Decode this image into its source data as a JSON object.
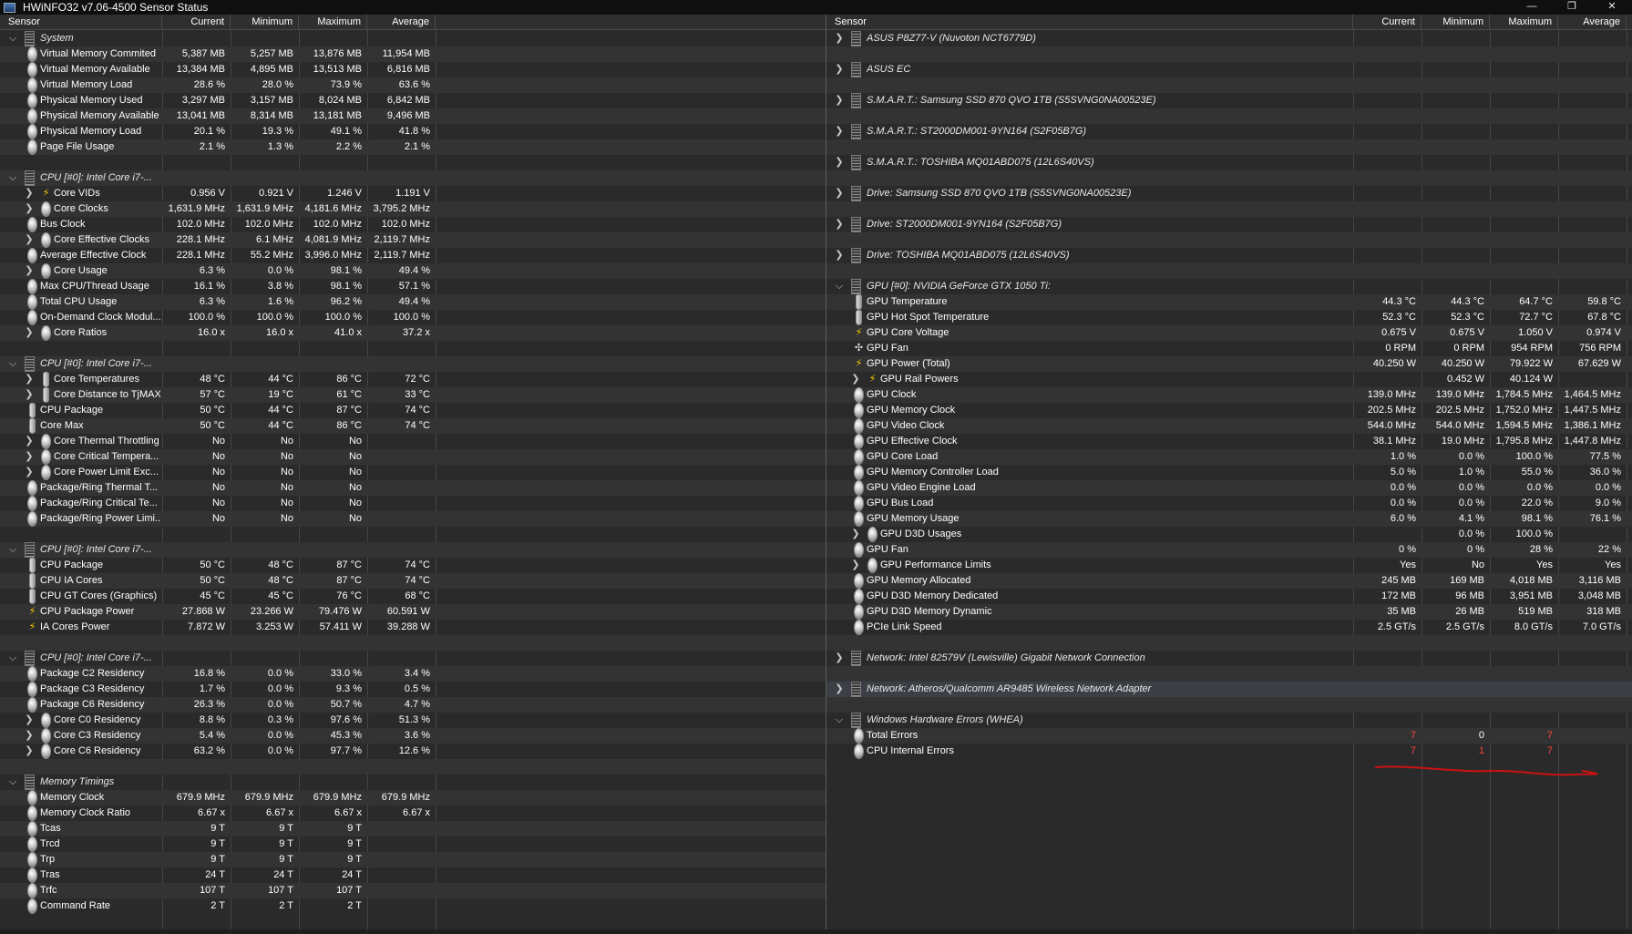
{
  "window": {
    "title": "HWiNFO32 v7.06-4500 Sensor Status",
    "minimize_glyph": "—",
    "restore_glyph": "❐",
    "close_glyph": "✕"
  },
  "columns": [
    "Sensor",
    "Current",
    "Minimum",
    "Maximum",
    "Average"
  ],
  "colors": {
    "background": "#2a2a2a",
    "alt_row": "#333333",
    "selected_row": "#3c4046",
    "error_value": "#ff4040",
    "voltage_icon": "#ffcc00",
    "annotation_line": "#cc1111"
  },
  "left_panel": {
    "rows": [
      {
        "type": "group",
        "label": "System"
      },
      {
        "type": "item",
        "indent": 0,
        "icon": "dot",
        "label": "Virtual Memory Commited",
        "cur": "5,387 MB",
        "min": "5,257 MB",
        "max": "13,876 MB",
        "avg": "11,954 MB"
      },
      {
        "type": "item",
        "indent": 0,
        "icon": "dot",
        "label": "Virtual Memory Available",
        "cur": "13,384 MB",
        "min": "4,895 MB",
        "max": "13,513 MB",
        "avg": "6,816 MB"
      },
      {
        "type": "item",
        "indent": 0,
        "icon": "dot",
        "label": "Virtual Memory Load",
        "cur": "28.6 %",
        "min": "28.0 %",
        "max": "73.9 %",
        "avg": "63.6 %"
      },
      {
        "type": "item",
        "indent": 0,
        "icon": "dot",
        "label": "Physical Memory Used",
        "cur": "3,297 MB",
        "min": "3,157 MB",
        "max": "8,024 MB",
        "avg": "6,842 MB"
      },
      {
        "type": "item",
        "indent": 0,
        "icon": "dot",
        "label": "Physical Memory Available",
        "cur": "13,041 MB",
        "min": "8,314 MB",
        "max": "13,181 MB",
        "avg": "9,496 MB"
      },
      {
        "type": "item",
        "indent": 0,
        "icon": "dot",
        "label": "Physical Memory Load",
        "cur": "20.1 %",
        "min": "19.3 %",
        "max": "49.1 %",
        "avg": "41.8 %"
      },
      {
        "type": "item",
        "indent": 0,
        "icon": "dot",
        "label": "Page File Usage",
        "cur": "2.1 %",
        "min": "1.3 %",
        "max": "2.2 %",
        "avg": "2.1 %"
      },
      {
        "type": "spacer"
      },
      {
        "type": "group",
        "label": "CPU [#0]: Intel Core i7-..."
      },
      {
        "type": "item",
        "indent": 1,
        "expand": true,
        "icon": "bolt",
        "label": "Core VIDs",
        "cur": "0.956 V",
        "min": "0.921 V",
        "max": "1.246 V",
        "avg": "1.191 V"
      },
      {
        "type": "item",
        "indent": 1,
        "expand": true,
        "icon": "dot",
        "label": "Core Clocks",
        "cur": "1,631.9 MHz",
        "min": "1,631.9 MHz",
        "max": "4,181.6 MHz",
        "avg": "3,795.2 MHz"
      },
      {
        "type": "item",
        "indent": 0,
        "icon": "dot",
        "label": "Bus Clock",
        "cur": "102.0 MHz",
        "min": "102.0 MHz",
        "max": "102.0 MHz",
        "avg": "102.0 MHz"
      },
      {
        "type": "item",
        "indent": 1,
        "expand": true,
        "icon": "dot",
        "label": "Core Effective Clocks",
        "cur": "228.1 MHz",
        "min": "6.1 MHz",
        "max": "4,081.9 MHz",
        "avg": "2,119.7 MHz"
      },
      {
        "type": "item",
        "indent": 0,
        "icon": "dot",
        "label": "Average Effective Clock",
        "cur": "228.1 MHz",
        "min": "55.2 MHz",
        "max": "3,996.0 MHz",
        "avg": "2,119.7 MHz"
      },
      {
        "type": "item",
        "indent": 1,
        "expand": true,
        "icon": "dot",
        "label": "Core Usage",
        "cur": "6.3 %",
        "min": "0.0 %",
        "max": "98.1 %",
        "avg": "49.4 %"
      },
      {
        "type": "item",
        "indent": 0,
        "icon": "dot",
        "label": "Max CPU/Thread Usage",
        "cur": "16.1 %",
        "min": "3.8 %",
        "max": "98.1 %",
        "avg": "57.1 %"
      },
      {
        "type": "item",
        "indent": 0,
        "icon": "dot",
        "label": "Total CPU Usage",
        "cur": "6.3 %",
        "min": "1.6 %",
        "max": "96.2 %",
        "avg": "49.4 %"
      },
      {
        "type": "item",
        "indent": 0,
        "icon": "dot",
        "label": "On-Demand Clock Modul...",
        "cur": "100.0 %",
        "min": "100.0 %",
        "max": "100.0 %",
        "avg": "100.0 %"
      },
      {
        "type": "item",
        "indent": 1,
        "expand": true,
        "icon": "dot",
        "label": "Core Ratios",
        "cur": "16.0 x",
        "min": "16.0 x",
        "max": "41.0 x",
        "avg": "37.2 x"
      },
      {
        "type": "spacer"
      },
      {
        "type": "group",
        "label": "CPU [#0]: Intel Core i7-..."
      },
      {
        "type": "item",
        "indent": 1,
        "expand": true,
        "icon": "therm",
        "label": "Core Temperatures",
        "cur": "48 °C",
        "min": "44 °C",
        "max": "86 °C",
        "avg": "72 °C"
      },
      {
        "type": "item",
        "indent": 1,
        "expand": true,
        "icon": "therm",
        "label": "Core Distance to TjMAX",
        "cur": "57 °C",
        "min": "19 °C",
        "max": "61 °C",
        "avg": "33 °C"
      },
      {
        "type": "item",
        "indent": 0,
        "icon": "therm",
        "label": "CPU Package",
        "cur": "50 °C",
        "min": "44 °C",
        "max": "87 °C",
        "avg": "74 °C"
      },
      {
        "type": "item",
        "indent": 0,
        "icon": "therm",
        "label": "Core Max",
        "cur": "50 °C",
        "min": "44 °C",
        "max": "86 °C",
        "avg": "74 °C"
      },
      {
        "type": "item",
        "indent": 1,
        "expand": true,
        "icon": "dot",
        "label": "Core Thermal Throttling",
        "cur": "No",
        "min": "No",
        "max": "No",
        "avg": ""
      },
      {
        "type": "item",
        "indent": 1,
        "expand": true,
        "icon": "dot",
        "label": "Core Critical Tempera...",
        "cur": "No",
        "min": "No",
        "max": "No",
        "avg": ""
      },
      {
        "type": "item",
        "indent": 1,
        "expand": true,
        "icon": "dot",
        "label": "Core Power Limit Exc...",
        "cur": "No",
        "min": "No",
        "max": "No",
        "avg": ""
      },
      {
        "type": "item",
        "indent": 0,
        "icon": "dot",
        "label": "Package/Ring Thermal T...",
        "cur": "No",
        "min": "No",
        "max": "No",
        "avg": ""
      },
      {
        "type": "item",
        "indent": 0,
        "icon": "dot",
        "label": "Package/Ring Critical Te...",
        "cur": "No",
        "min": "No",
        "max": "No",
        "avg": ""
      },
      {
        "type": "item",
        "indent": 0,
        "icon": "dot",
        "label": "Package/Ring Power Limi...",
        "cur": "No",
        "min": "No",
        "max": "No",
        "avg": ""
      },
      {
        "type": "spacer"
      },
      {
        "type": "group",
        "label": "CPU [#0]: Intel Core i7-..."
      },
      {
        "type": "item",
        "indent": 0,
        "icon": "therm",
        "label": "CPU Package",
        "cur": "50 °C",
        "min": "48 °C",
        "max": "87 °C",
        "avg": "74 °C"
      },
      {
        "type": "item",
        "indent": 0,
        "icon": "therm",
        "label": "CPU IA Cores",
        "cur": "50 °C",
        "min": "48 °C",
        "max": "87 °C",
        "avg": "74 °C"
      },
      {
        "type": "item",
        "indent": 0,
        "icon": "therm",
        "label": "CPU GT Cores (Graphics)",
        "cur": "45 °C",
        "min": "45 °C",
        "max": "76 °C",
        "avg": "68 °C"
      },
      {
        "type": "item",
        "indent": 0,
        "icon": "bolt",
        "label": "CPU Package Power",
        "cur": "27.868 W",
        "min": "23.266 W",
        "max": "79.476 W",
        "avg": "60.591 W"
      },
      {
        "type": "item",
        "indent": 0,
        "icon": "bolt",
        "label": "IA Cores Power",
        "cur": "7.872 W",
        "min": "3.253 W",
        "max": "57.411 W",
        "avg": "39.288 W"
      },
      {
        "type": "spacer"
      },
      {
        "type": "group",
        "label": "CPU [#0]: Intel Core i7-..."
      },
      {
        "type": "item",
        "indent": 0,
        "icon": "dot",
        "label": "Package C2 Residency",
        "cur": "16.8 %",
        "min": "0.0 %",
        "max": "33.0 %",
        "avg": "3.4 %"
      },
      {
        "type": "item",
        "indent": 0,
        "icon": "dot",
        "label": "Package C3 Residency",
        "cur": "1.7 %",
        "min": "0.0 %",
        "max": "9.3 %",
        "avg": "0.5 %"
      },
      {
        "type": "item",
        "indent": 0,
        "icon": "dot",
        "label": "Package C6 Residency",
        "cur": "26.3 %",
        "min": "0.0 %",
        "max": "50.7 %",
        "avg": "4.7 %"
      },
      {
        "type": "item",
        "indent": 1,
        "expand": true,
        "icon": "dot",
        "label": "Core C0 Residency",
        "cur": "8.8 %",
        "min": "0.3 %",
        "max": "97.6 %",
        "avg": "51.3 %"
      },
      {
        "type": "item",
        "indent": 1,
        "expand": true,
        "icon": "dot",
        "label": "Core C3 Residency",
        "cur": "5.4 %",
        "min": "0.0 %",
        "max": "45.3 %",
        "avg": "3.6 %"
      },
      {
        "type": "item",
        "indent": 1,
        "expand": true,
        "icon": "dot",
        "label": "Core C6 Residency",
        "cur": "63.2 %",
        "min": "0.0 %",
        "max": "97.7 %",
        "avg": "12.6 %"
      },
      {
        "type": "spacer"
      },
      {
        "type": "group",
        "label": "Memory Timings"
      },
      {
        "type": "item",
        "indent": 0,
        "icon": "dot",
        "label": "Memory Clock",
        "cur": "679.9 MHz",
        "min": "679.9 MHz",
        "max": "679.9 MHz",
        "avg": "679.9 MHz"
      },
      {
        "type": "item",
        "indent": 0,
        "icon": "dot",
        "label": "Memory Clock Ratio",
        "cur": "6.67 x",
        "min": "6.67 x",
        "max": "6.67 x",
        "avg": "6.67 x"
      },
      {
        "type": "item",
        "indent": 0,
        "icon": "dot",
        "label": "Tcas",
        "cur": "9 T",
        "min": "9 T",
        "max": "9 T",
        "avg": ""
      },
      {
        "type": "item",
        "indent": 0,
        "icon": "dot",
        "label": "Trcd",
        "cur": "9 T",
        "min": "9 T",
        "max": "9 T",
        "avg": ""
      },
      {
        "type": "item",
        "indent": 0,
        "icon": "dot",
        "label": "Trp",
        "cur": "9 T",
        "min": "9 T",
        "max": "9 T",
        "avg": ""
      },
      {
        "type": "item",
        "indent": 0,
        "icon": "dot",
        "label": "Tras",
        "cur": "24 T",
        "min": "24 T",
        "max": "24 T",
        "avg": ""
      },
      {
        "type": "item",
        "indent": 0,
        "icon": "dot",
        "label": "Trfc",
        "cur": "107 T",
        "min": "107 T",
        "max": "107 T",
        "avg": ""
      },
      {
        "type": "item",
        "indent": 0,
        "icon": "dot",
        "label": "Command Rate",
        "cur": "2 T",
        "min": "2 T",
        "max": "2 T",
        "avg": ""
      }
    ]
  },
  "right_panel": {
    "rows": [
      {
        "type": "group",
        "collapsed": true,
        "label": "ASUS P8Z77-V (Nuvoton NCT6779D)"
      },
      {
        "type": "spacer"
      },
      {
        "type": "group",
        "collapsed": true,
        "label": "ASUS EC"
      },
      {
        "type": "spacer"
      },
      {
        "type": "group",
        "collapsed": true,
        "label": "S.M.A.R.T.: Samsung SSD 870 QVO 1TB (S5SVNG0NA00523E)"
      },
      {
        "type": "spacer"
      },
      {
        "type": "group",
        "collapsed": true,
        "label": "S.M.A.R.T.: ST2000DM001-9YN164 (S2F05B7G)"
      },
      {
        "type": "spacer"
      },
      {
        "type": "group",
        "collapsed": true,
        "label": "S.M.A.R.T.: TOSHIBA MQ01ABD075 (12L6S40VS)"
      },
      {
        "type": "spacer"
      },
      {
        "type": "group",
        "collapsed": true,
        "label": "Drive: Samsung SSD 870 QVO 1TB (S5SVNG0NA00523E)"
      },
      {
        "type": "spacer"
      },
      {
        "type": "group",
        "collapsed": true,
        "label": "Drive: ST2000DM001-9YN164 (S2F05B7G)"
      },
      {
        "type": "spacer"
      },
      {
        "type": "group",
        "collapsed": true,
        "label": "Drive: TOSHIBA MQ01ABD075 (12L6S40VS)"
      },
      {
        "type": "spacer"
      },
      {
        "type": "group",
        "label": "GPU [#0]: NVIDIA GeForce GTX 1050 Ti:"
      },
      {
        "type": "item",
        "indent": 0,
        "icon": "therm",
        "label": "GPU Temperature",
        "cur": "44.3 °C",
        "min": "44.3 °C",
        "max": "64.7 °C",
        "avg": "59.8 °C"
      },
      {
        "type": "item",
        "indent": 0,
        "icon": "therm",
        "label": "GPU Hot Spot Temperature",
        "cur": "52.3 °C",
        "min": "52.3 °C",
        "max": "72.7 °C",
        "avg": "67.8 °C"
      },
      {
        "type": "item",
        "indent": 0,
        "icon": "bolt",
        "label": "GPU Core Voltage",
        "cur": "0.675 V",
        "min": "0.675 V",
        "max": "1.050 V",
        "avg": "0.974 V"
      },
      {
        "type": "item",
        "indent": 0,
        "icon": "fan",
        "label": "GPU Fan",
        "cur": "0 RPM",
        "min": "0 RPM",
        "max": "954 RPM",
        "avg": "756 RPM"
      },
      {
        "type": "item",
        "indent": 0,
        "icon": "bolt",
        "label": "GPU Power (Total)",
        "cur": "40.250 W",
        "min": "40.250 W",
        "max": "79.922 W",
        "avg": "67.629 W"
      },
      {
        "type": "item",
        "indent": 1,
        "expand": true,
        "icon": "bolt",
        "label": "GPU Rail Powers",
        "cur": "",
        "min": "0.452 W",
        "max": "40.124 W",
        "avg": ""
      },
      {
        "type": "item",
        "indent": 0,
        "icon": "dot",
        "label": "GPU Clock",
        "cur": "139.0 MHz",
        "min": "139.0 MHz",
        "max": "1,784.5 MHz",
        "avg": "1,464.5 MHz"
      },
      {
        "type": "item",
        "indent": 0,
        "icon": "dot",
        "label": "GPU Memory Clock",
        "cur": "202.5 MHz",
        "min": "202.5 MHz",
        "max": "1,752.0 MHz",
        "avg": "1,447.5 MHz"
      },
      {
        "type": "item",
        "indent": 0,
        "icon": "dot",
        "label": "GPU Video Clock",
        "cur": "544.0 MHz",
        "min": "544.0 MHz",
        "max": "1,594.5 MHz",
        "avg": "1,386.1 MHz"
      },
      {
        "type": "item",
        "indent": 0,
        "icon": "dot",
        "label": "GPU Effective Clock",
        "cur": "38.1 MHz",
        "min": "19.0 MHz",
        "max": "1,795.8 MHz",
        "avg": "1,447.8 MHz"
      },
      {
        "type": "item",
        "indent": 0,
        "icon": "dot",
        "label": "GPU Core Load",
        "cur": "1.0 %",
        "min": "0.0 %",
        "max": "100.0 %",
        "avg": "77.5 %"
      },
      {
        "type": "item",
        "indent": 0,
        "icon": "dot",
        "label": "GPU Memory Controller Load",
        "cur": "5.0 %",
        "min": "1.0 %",
        "max": "55.0 %",
        "avg": "36.0 %"
      },
      {
        "type": "item",
        "indent": 0,
        "icon": "dot",
        "label": "GPU Video Engine Load",
        "cur": "0.0 %",
        "min": "0.0 %",
        "max": "0.0 %",
        "avg": "0.0 %"
      },
      {
        "type": "item",
        "indent": 0,
        "icon": "dot",
        "label": "GPU Bus Load",
        "cur": "0.0 %",
        "min": "0.0 %",
        "max": "22.0 %",
        "avg": "9.0 %"
      },
      {
        "type": "item",
        "indent": 0,
        "icon": "dot",
        "label": "GPU Memory Usage",
        "cur": "6.0 %",
        "min": "4.1 %",
        "max": "98.1 %",
        "avg": "76.1 %"
      },
      {
        "type": "item",
        "indent": 1,
        "expand": true,
        "icon": "dot",
        "label": "GPU D3D Usages",
        "cur": "",
        "min": "0.0 %",
        "max": "100.0 %",
        "avg": ""
      },
      {
        "type": "item",
        "indent": 0,
        "icon": "dot",
        "label": "GPU Fan",
        "cur": "0 %",
        "min": "0 %",
        "max": "28 %",
        "avg": "22 %"
      },
      {
        "type": "item",
        "indent": 1,
        "expand": true,
        "icon": "dot",
        "label": "GPU Performance Limits",
        "cur": "Yes",
        "min": "No",
        "max": "Yes",
        "avg": "Yes"
      },
      {
        "type": "item",
        "indent": 0,
        "icon": "dot",
        "label": "GPU Memory Allocated",
        "cur": "245 MB",
        "min": "169 MB",
        "max": "4,018 MB",
        "avg": "3,116 MB"
      },
      {
        "type": "item",
        "indent": 0,
        "icon": "dot",
        "label": "GPU D3D Memory Dedicated",
        "cur": "172 MB",
        "min": "96 MB",
        "max": "3,951 MB",
        "avg": "3,048 MB"
      },
      {
        "type": "item",
        "indent": 0,
        "icon": "dot",
        "label": "GPU D3D Memory Dynamic",
        "cur": "35 MB",
        "min": "26 MB",
        "max": "519 MB",
        "avg": "318 MB"
      },
      {
        "type": "item",
        "indent": 0,
        "icon": "dot",
        "label": "PCIe Link Speed",
        "cur": "2.5 GT/s",
        "min": "2.5 GT/s",
        "max": "8.0 GT/s",
        "avg": "7.0 GT/s"
      },
      {
        "type": "spacer"
      },
      {
        "type": "group",
        "collapsed": true,
        "label": "Network: Intel 82579V (Lewisville) Gigabit Network Connection"
      },
      {
        "type": "spacer"
      },
      {
        "type": "group",
        "collapsed": true,
        "selected": true,
        "label": "Network: Atheros/Qualcomm AR9485 Wireless Network Adapter"
      },
      {
        "type": "spacer"
      },
      {
        "type": "group",
        "label": "Windows Hardware Errors (WHEA)"
      },
      {
        "type": "item",
        "indent": 0,
        "icon": "dot",
        "label": "Total Errors",
        "cur": "7",
        "min": "0",
        "max": "7",
        "avg": "",
        "red": [
          "cur",
          "max"
        ]
      },
      {
        "type": "item",
        "indent": 0,
        "icon": "dot",
        "label": "CPU Internal Errors",
        "cur": "7",
        "min": "1",
        "max": "7",
        "avg": "",
        "red": [
          "cur",
          "min",
          "max"
        ]
      }
    ]
  }
}
